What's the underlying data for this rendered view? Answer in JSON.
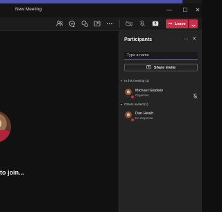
{
  "colors": {
    "accent": "#4f52b2",
    "leave": "#c4314b",
    "panel_bg": "#242424",
    "stage_bg": "#111111"
  },
  "window": {
    "title": "New Meeting",
    "controls": [
      "minimize",
      "maximize",
      "close"
    ]
  },
  "toolbar": {
    "icons": [
      "people-icon",
      "chat-icon",
      "reactions-icon",
      "share-screen-icon",
      "more-icon",
      "camera-icon",
      "mic-icon",
      "share-tray-icon"
    ],
    "leave_label": "Leave"
  },
  "stage": {
    "message": "to join..."
  },
  "participants_panel": {
    "title": "Participants",
    "search_placeholder": "Type a name",
    "share_invite_label": "Share invite",
    "in_meeting": {
      "label": "In this meeting (1)",
      "people": [
        {
          "name": "Michael Gladwin",
          "role": "Organizer"
        }
      ]
    },
    "others_invited": {
      "label": "Others invited (1)",
      "people": [
        {
          "name": "Dan Heath",
          "role": "No response"
        }
      ]
    }
  }
}
